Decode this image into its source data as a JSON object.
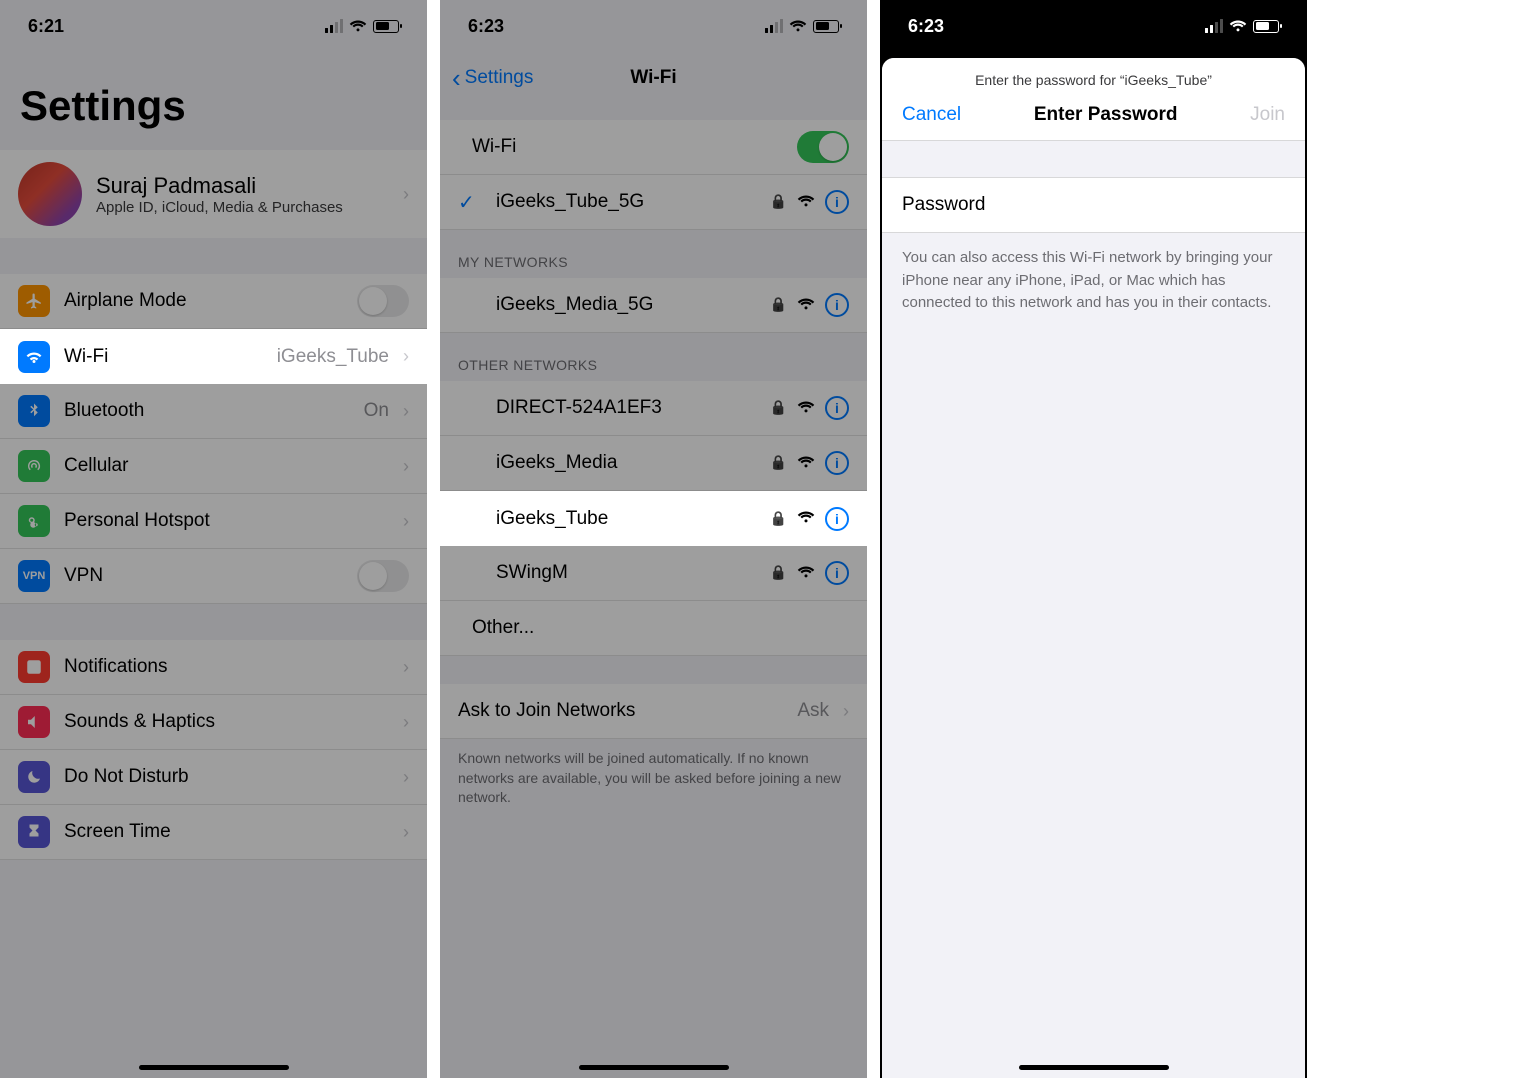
{
  "screen1": {
    "time": "6:21",
    "title": "Settings",
    "profile": {
      "name": "Suraj Padmasali",
      "subtitle": "Apple ID, iCloud, Media & Purchases"
    },
    "items": {
      "airplane": "Airplane Mode",
      "wifi": "Wi-Fi",
      "wifi_value": "iGeeks_Tube",
      "bluetooth": "Bluetooth",
      "bluetooth_value": "On",
      "cellular": "Cellular",
      "hotspot": "Personal Hotspot",
      "vpn": "VPN",
      "notifications": "Notifications",
      "sounds": "Sounds & Haptics",
      "dnd": "Do Not Disturb",
      "screentime": "Screen Time"
    }
  },
  "screen2": {
    "time": "6:23",
    "back": "Settings",
    "title": "Wi-Fi",
    "wifi_label": "Wi-Fi",
    "current_net": "iGeeks_Tube_5G",
    "section_my": "MY NETWORKS",
    "my_nets": {
      "n0": "iGeeks_Media_5G"
    },
    "section_other": "OTHER NETWORKS",
    "other_nets": {
      "n0": "DIRECT-524A1EF3",
      "n1": "iGeeks_Media",
      "n2": "iGeeks_Tube",
      "n3": "SWingM",
      "other": "Other..."
    },
    "ask_label": "Ask to Join Networks",
    "ask_value": "Ask",
    "footer": "Known networks will be joined automatically. If no known networks are available, you will be asked before joining a new network."
  },
  "screen3": {
    "time": "6:23",
    "subtitle": "Enter the password for “iGeeks_Tube”",
    "cancel": "Cancel",
    "title": "Enter Password",
    "join": "Join",
    "field_label": "Password",
    "hint": "You can also access this Wi-Fi network by bringing your iPhone near any iPhone, iPad, or Mac which has connected to this network and has you in their contacts."
  }
}
